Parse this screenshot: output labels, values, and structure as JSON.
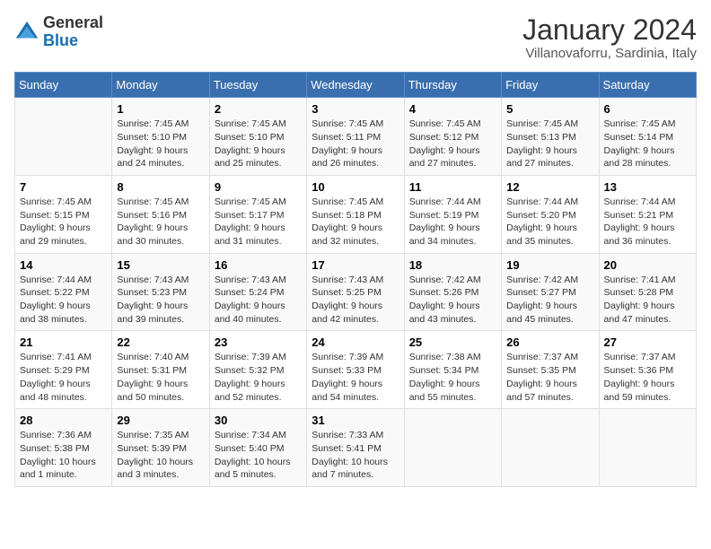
{
  "logo": {
    "text_general": "General",
    "text_blue": "Blue"
  },
  "title": "January 2024",
  "location": "Villanovaforru, Sardinia, Italy",
  "days_of_week": [
    "Sunday",
    "Monday",
    "Tuesday",
    "Wednesday",
    "Thursday",
    "Friday",
    "Saturday"
  ],
  "weeks": [
    [
      {
        "day": "",
        "sunrise": "",
        "sunset": "",
        "daylight": ""
      },
      {
        "day": "1",
        "sunrise": "Sunrise: 7:45 AM",
        "sunset": "Sunset: 5:10 PM",
        "daylight": "Daylight: 9 hours and 24 minutes."
      },
      {
        "day": "2",
        "sunrise": "Sunrise: 7:45 AM",
        "sunset": "Sunset: 5:10 PM",
        "daylight": "Daylight: 9 hours and 25 minutes."
      },
      {
        "day": "3",
        "sunrise": "Sunrise: 7:45 AM",
        "sunset": "Sunset: 5:11 PM",
        "daylight": "Daylight: 9 hours and 26 minutes."
      },
      {
        "day": "4",
        "sunrise": "Sunrise: 7:45 AM",
        "sunset": "Sunset: 5:12 PM",
        "daylight": "Daylight: 9 hours and 27 minutes."
      },
      {
        "day": "5",
        "sunrise": "Sunrise: 7:45 AM",
        "sunset": "Sunset: 5:13 PM",
        "daylight": "Daylight: 9 hours and 27 minutes."
      },
      {
        "day": "6",
        "sunrise": "Sunrise: 7:45 AM",
        "sunset": "Sunset: 5:14 PM",
        "daylight": "Daylight: 9 hours and 28 minutes."
      }
    ],
    [
      {
        "day": "7",
        "sunrise": "Sunrise: 7:45 AM",
        "sunset": "Sunset: 5:15 PM",
        "daylight": "Daylight: 9 hours and 29 minutes."
      },
      {
        "day": "8",
        "sunrise": "Sunrise: 7:45 AM",
        "sunset": "Sunset: 5:16 PM",
        "daylight": "Daylight: 9 hours and 30 minutes."
      },
      {
        "day": "9",
        "sunrise": "Sunrise: 7:45 AM",
        "sunset": "Sunset: 5:17 PM",
        "daylight": "Daylight: 9 hours and 31 minutes."
      },
      {
        "day": "10",
        "sunrise": "Sunrise: 7:45 AM",
        "sunset": "Sunset: 5:18 PM",
        "daylight": "Daylight: 9 hours and 32 minutes."
      },
      {
        "day": "11",
        "sunrise": "Sunrise: 7:44 AM",
        "sunset": "Sunset: 5:19 PM",
        "daylight": "Daylight: 9 hours and 34 minutes."
      },
      {
        "day": "12",
        "sunrise": "Sunrise: 7:44 AM",
        "sunset": "Sunset: 5:20 PM",
        "daylight": "Daylight: 9 hours and 35 minutes."
      },
      {
        "day": "13",
        "sunrise": "Sunrise: 7:44 AM",
        "sunset": "Sunset: 5:21 PM",
        "daylight": "Daylight: 9 hours and 36 minutes."
      }
    ],
    [
      {
        "day": "14",
        "sunrise": "Sunrise: 7:44 AM",
        "sunset": "Sunset: 5:22 PM",
        "daylight": "Daylight: 9 hours and 38 minutes."
      },
      {
        "day": "15",
        "sunrise": "Sunrise: 7:43 AM",
        "sunset": "Sunset: 5:23 PM",
        "daylight": "Daylight: 9 hours and 39 minutes."
      },
      {
        "day": "16",
        "sunrise": "Sunrise: 7:43 AM",
        "sunset": "Sunset: 5:24 PM",
        "daylight": "Daylight: 9 hours and 40 minutes."
      },
      {
        "day": "17",
        "sunrise": "Sunrise: 7:43 AM",
        "sunset": "Sunset: 5:25 PM",
        "daylight": "Daylight: 9 hours and 42 minutes."
      },
      {
        "day": "18",
        "sunrise": "Sunrise: 7:42 AM",
        "sunset": "Sunset: 5:26 PM",
        "daylight": "Daylight: 9 hours and 43 minutes."
      },
      {
        "day": "19",
        "sunrise": "Sunrise: 7:42 AM",
        "sunset": "Sunset: 5:27 PM",
        "daylight": "Daylight: 9 hours and 45 minutes."
      },
      {
        "day": "20",
        "sunrise": "Sunrise: 7:41 AM",
        "sunset": "Sunset: 5:28 PM",
        "daylight": "Daylight: 9 hours and 47 minutes."
      }
    ],
    [
      {
        "day": "21",
        "sunrise": "Sunrise: 7:41 AM",
        "sunset": "Sunset: 5:29 PM",
        "daylight": "Daylight: 9 hours and 48 minutes."
      },
      {
        "day": "22",
        "sunrise": "Sunrise: 7:40 AM",
        "sunset": "Sunset: 5:31 PM",
        "daylight": "Daylight: 9 hours and 50 minutes."
      },
      {
        "day": "23",
        "sunrise": "Sunrise: 7:39 AM",
        "sunset": "Sunset: 5:32 PM",
        "daylight": "Daylight: 9 hours and 52 minutes."
      },
      {
        "day": "24",
        "sunrise": "Sunrise: 7:39 AM",
        "sunset": "Sunset: 5:33 PM",
        "daylight": "Daylight: 9 hours and 54 minutes."
      },
      {
        "day": "25",
        "sunrise": "Sunrise: 7:38 AM",
        "sunset": "Sunset: 5:34 PM",
        "daylight": "Daylight: 9 hours and 55 minutes."
      },
      {
        "day": "26",
        "sunrise": "Sunrise: 7:37 AM",
        "sunset": "Sunset: 5:35 PM",
        "daylight": "Daylight: 9 hours and 57 minutes."
      },
      {
        "day": "27",
        "sunrise": "Sunrise: 7:37 AM",
        "sunset": "Sunset: 5:36 PM",
        "daylight": "Daylight: 9 hours and 59 minutes."
      }
    ],
    [
      {
        "day": "28",
        "sunrise": "Sunrise: 7:36 AM",
        "sunset": "Sunset: 5:38 PM",
        "daylight": "Daylight: 10 hours and 1 minute."
      },
      {
        "day": "29",
        "sunrise": "Sunrise: 7:35 AM",
        "sunset": "Sunset: 5:39 PM",
        "daylight": "Daylight: 10 hours and 3 minutes."
      },
      {
        "day": "30",
        "sunrise": "Sunrise: 7:34 AM",
        "sunset": "Sunset: 5:40 PM",
        "daylight": "Daylight: 10 hours and 5 minutes."
      },
      {
        "day": "31",
        "sunrise": "Sunrise: 7:33 AM",
        "sunset": "Sunset: 5:41 PM",
        "daylight": "Daylight: 10 hours and 7 minutes."
      },
      {
        "day": "",
        "sunrise": "",
        "sunset": "",
        "daylight": ""
      },
      {
        "day": "",
        "sunrise": "",
        "sunset": "",
        "daylight": ""
      },
      {
        "day": "",
        "sunrise": "",
        "sunset": "",
        "daylight": ""
      }
    ]
  ]
}
